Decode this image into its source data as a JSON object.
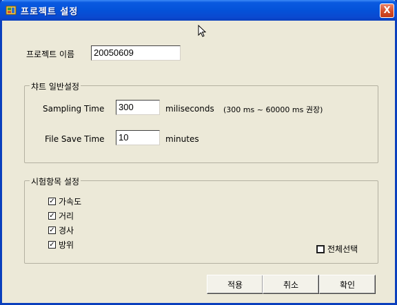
{
  "window": {
    "title": "프로젝트 설정",
    "close_label": "X"
  },
  "project": {
    "name_label": "프로젝트 이름",
    "name_value": "20050609"
  },
  "chart_group": {
    "title": "챠트 일반설정",
    "sampling_label": "Sampling Time",
    "sampling_value": "300",
    "sampling_unit": "miliseconds",
    "sampling_hint": "(300 ms ~ 60000  ms 권장)",
    "save_label": "File Save Time",
    "save_value": "10",
    "save_unit": "minutes"
  },
  "test_group": {
    "title": "시험항목 설정",
    "items": [
      {
        "label": "가속도",
        "checked": true
      },
      {
        "label": "거리",
        "checked": true
      },
      {
        "label": "경사",
        "checked": true
      },
      {
        "label": "방위",
        "checked": true
      }
    ],
    "select_all_label": "전체선택",
    "select_all_checked": false
  },
  "buttons": {
    "apply": "적용",
    "cancel": "취소",
    "ok": "확인"
  }
}
